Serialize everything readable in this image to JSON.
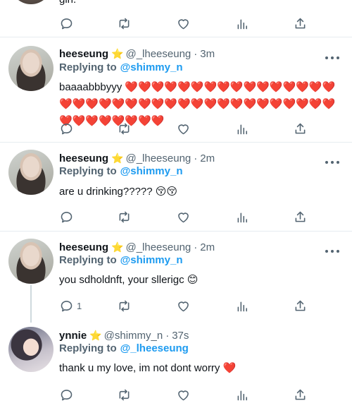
{
  "partial_tweet": {
    "text": "girl."
  },
  "tweets": [
    {
      "name": "heeseung",
      "star": "⭐",
      "handle": "@_lheeseung",
      "time": "3m",
      "replying_label": "Replying to",
      "replying_to": "@shimmy_n",
      "text": "baaaabbbyyy ❤️❤️❤️❤️❤️❤️❤️❤️❤️❤️❤️❤️❤️❤️❤️❤️❤️❤️❤️❤️❤️❤️❤️❤️❤️❤️❤️❤️❤️❤️❤️❤️❤️❤️❤️❤️❤️❤️❤️❤️❤️❤️❤️❤️❤️",
      "reply_count": ""
    },
    {
      "name": "heeseung",
      "star": "⭐",
      "handle": "@_lheeseung",
      "time": "2m",
      "replying_label": "Replying to",
      "replying_to": "@shimmy_n",
      "text": "are u drinking????? 😚😚",
      "reply_count": ""
    },
    {
      "name": "heeseung",
      "star": "⭐",
      "handle": "@_lheeseung",
      "time": "2m",
      "replying_label": "Replying to",
      "replying_to": "@shimmy_n",
      "text": "you sdholdnft, your sllerigc 😊",
      "reply_count": "1"
    },
    {
      "name": "ynnie",
      "star": "⭐",
      "handle": "@shimmy_n",
      "time": "37s",
      "replying_label": "Replying to",
      "replying_to": "@_lheeseung",
      "text": "thank u my love, im not dont worry ❤️",
      "reply_count": ""
    }
  ],
  "icons": [
    "reply-icon",
    "retweet-icon",
    "like-icon",
    "stats-icon",
    "share-icon",
    "more-icon"
  ],
  "colors": {
    "link": "#1d9bf0",
    "muted": "#536471",
    "divider": "#e6ecf0",
    "heart": "#e0245e"
  }
}
